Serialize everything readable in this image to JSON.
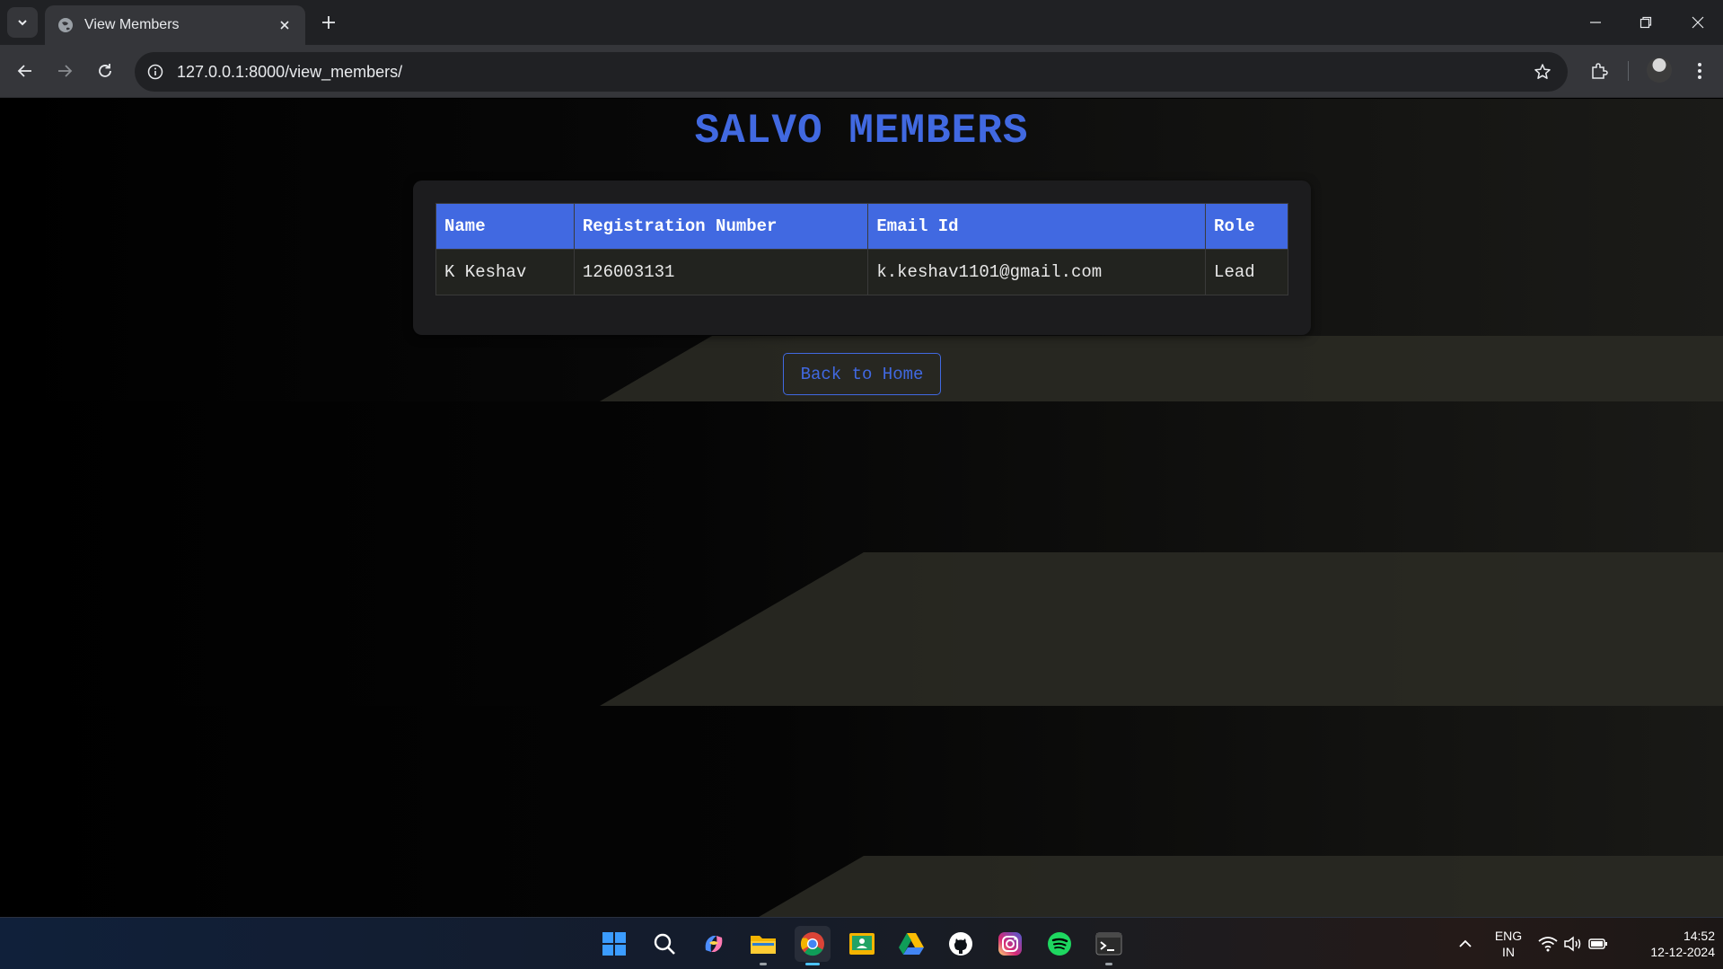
{
  "browser": {
    "tab_title": "View Members",
    "url": "127.0.0.1:8000/view_members/"
  },
  "page": {
    "title": "SALVO MEMBERS",
    "table": {
      "headers": [
        "Name",
        "Registration Number",
        "Email Id",
        "Role"
      ],
      "rows": [
        [
          "K Keshav",
          "126003131",
          "k.keshav1101@gmail.com",
          "Lead"
        ]
      ]
    },
    "back_button": "Back to Home"
  },
  "taskbar": {
    "apps": [
      "windows-start",
      "search",
      "copilot",
      "file-explorer",
      "chrome",
      "google-classroom",
      "google-drive",
      "github",
      "instagram",
      "spotify",
      "terminal"
    ],
    "language_line1": "ENG",
    "language_line2": "IN",
    "time": "14:52",
    "date": "12-12-2024"
  },
  "colors": {
    "accent": "#4169e1",
    "table_row_bg": "#22231f",
    "card_bg": "#1c1c1e"
  }
}
